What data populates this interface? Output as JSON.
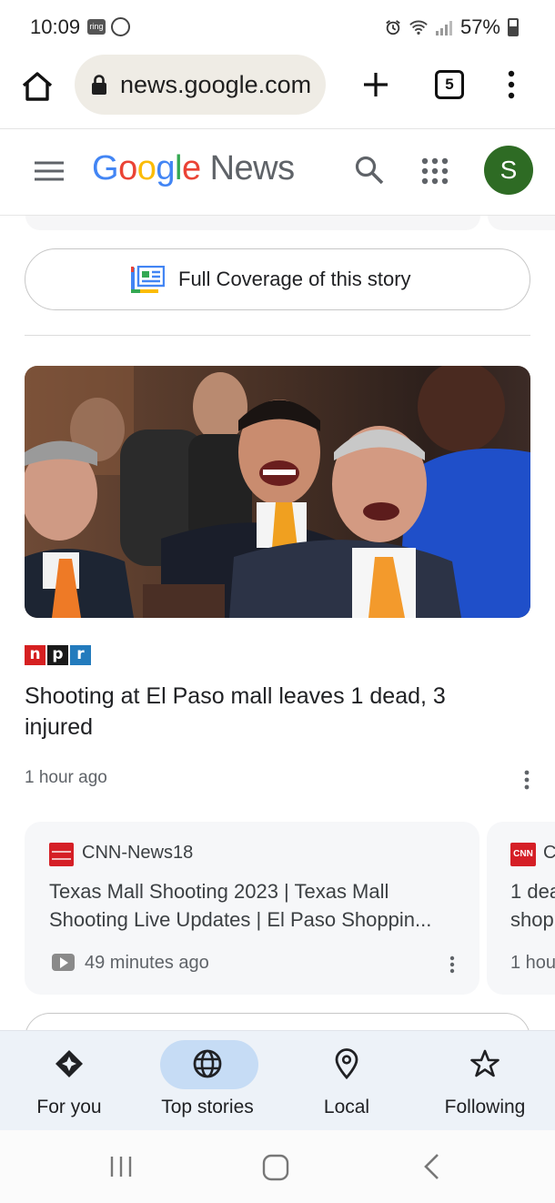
{
  "status_bar": {
    "time": "10:09",
    "ring_label": "ring",
    "battery": "57%"
  },
  "browser": {
    "url": "news.google.com",
    "tab_count": "5"
  },
  "header": {
    "logo_letters": [
      "G",
      "o",
      "o",
      "g",
      "l",
      "e"
    ],
    "logo_suffix": "News",
    "avatar_initial": "S",
    "avatar_color": "#2e6b24"
  },
  "full_coverage": {
    "label": "Full Coverage of this story"
  },
  "story": {
    "source_letters": [
      "n",
      "p",
      "r"
    ],
    "headline": "Shooting at El Paso mall leaves 1 dead, 3 injured",
    "time": "1 hour ago"
  },
  "related": [
    {
      "source": "CNN-News18",
      "title": "Texas Mall Shooting 2023 | Texas Mall Shooting Live Updates | El Paso Shoppin...",
      "time": "49 minutes ago",
      "icon": "video-icon"
    },
    {
      "logo_text": "CNN",
      "source": "C",
      "title_l1": "1 dea",
      "title_l2": "shop",
      "time": "1 hou"
    }
  ],
  "bottom_nav": [
    {
      "label": "For you",
      "icon": "diamond-sparkle-icon",
      "active": false
    },
    {
      "label": "Top stories",
      "icon": "globe-icon",
      "active": true
    },
    {
      "label": "Local",
      "icon": "location-pin-icon",
      "active": false
    },
    {
      "label": "Following",
      "icon": "star-outline-icon",
      "active": false
    }
  ],
  "colors": {
    "accent_pill": "#c6dcf5",
    "npr_n": "#d62021",
    "npr_p": "#1a1a1a",
    "npr_r": "#237bbd"
  }
}
